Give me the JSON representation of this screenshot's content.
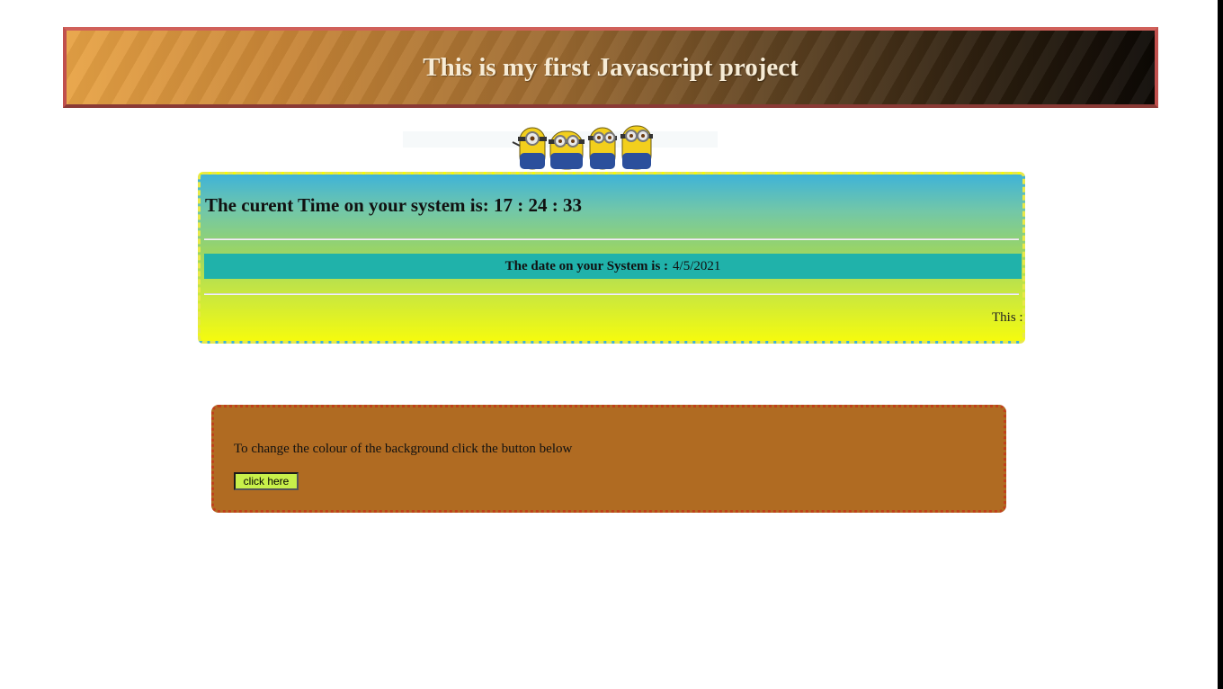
{
  "header": {
    "title": "This is my first Javascript project"
  },
  "clock": {
    "time_text": "The curent Time on your system is: 17 : 24 : 33",
    "date_label": "The date on your System is :",
    "date_value": "4/5/2021",
    "marquee_text": "This :"
  },
  "color_changer": {
    "instruction": "To change the colour of the background click the button below",
    "button_label": "click here"
  },
  "colors": {
    "banner_border": "#c0504d",
    "date_bar": "#20b2aa",
    "color_panel": "#b06b22",
    "button": "#c8f04a"
  },
  "icons": {
    "minions": "minions-illustration"
  }
}
